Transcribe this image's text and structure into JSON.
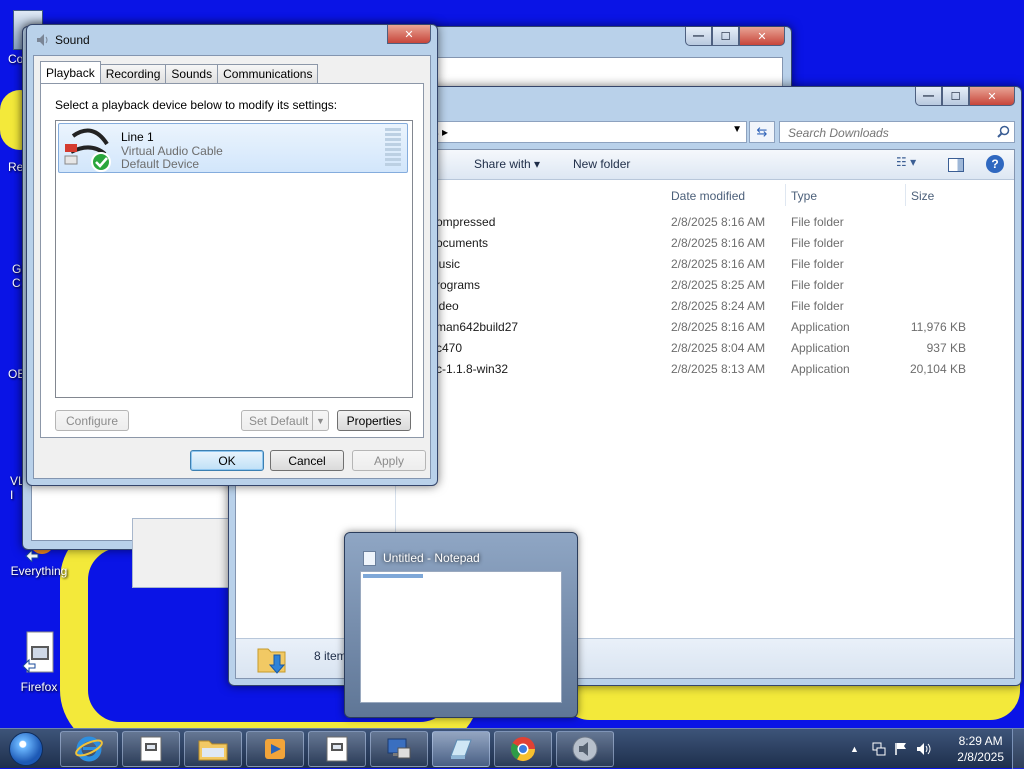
{
  "desktop": {
    "icons": [
      {
        "label": "Co"
      },
      {
        "label": "Re"
      },
      {
        "label": "G\nC"
      },
      {
        "label": "OB"
      },
      {
        "label": "VL\nI"
      },
      {
        "label": "Everything"
      },
      {
        "label": "Firefox"
      }
    ]
  },
  "explorer": {
    "address_crumb": "ds",
    "search_placeholder": "Search Downloads",
    "commands": {
      "share_with": "Share with",
      "new_folder": "New folder"
    },
    "columns": {
      "date": "Date modified",
      "type": "Type",
      "size": "Size"
    },
    "rows": [
      {
        "name": "ompressed",
        "date": "2/8/2025 8:16 AM",
        "type": "File folder",
        "size": ""
      },
      {
        "name": "ocuments",
        "date": "2/8/2025 8:16 AM",
        "type": "File folder",
        "size": ""
      },
      {
        "name": "lusic",
        "date": "2/8/2025 8:16 AM",
        "type": "File folder",
        "size": ""
      },
      {
        "name": "rograms",
        "date": "2/8/2025 8:25 AM",
        "type": "File folder",
        "size": ""
      },
      {
        "name": "ideo",
        "date": "2/8/2025 8:24 AM",
        "type": "File folder",
        "size": ""
      },
      {
        "name": "man642build27",
        "date": "2/8/2025 8:16 AM",
        "type": "Application",
        "size": "11,976 KB"
      },
      {
        "name": "c470",
        "date": "2/8/2025 8:04 AM",
        "type": "Application",
        "size": "937 KB"
      },
      {
        "name": "c-1.1.8-win32",
        "date": "2/8/2025 8:13 AM",
        "type": "Application",
        "size": "20,104 KB"
      }
    ],
    "status_count": "8 item"
  },
  "sound": {
    "title": "Sound",
    "tabs": [
      "Playback",
      "Recording",
      "Sounds",
      "Communications"
    ],
    "active_tab": "Playback",
    "instruction": "Select a playback device below to modify its settings:",
    "device": {
      "name": "Line 1",
      "description": "Virtual Audio Cable",
      "status": "Default Device"
    },
    "buttons": {
      "configure": "Configure",
      "set_default": "Set Default",
      "properties": "Properties",
      "ok": "OK",
      "cancel": "Cancel",
      "apply": "Apply"
    }
  },
  "notepad_thumb": {
    "title": "Untitled - Notepad"
  },
  "taskbar": {
    "time": "8:29 AM",
    "date": "2/8/2025",
    "apps": [
      "internet-explorer-icon",
      "notepad-icon",
      "file-explorer-icon",
      "media-player-icon",
      "notepad-icon",
      "remote-desktop-icon",
      "notepad-icon",
      "chrome-icon",
      "speaker-icon"
    ]
  },
  "colors": {
    "desktop": "#0a14e6",
    "wallpaper_accent": "#f3e93a",
    "taskbar": "#2a3d5e"
  }
}
